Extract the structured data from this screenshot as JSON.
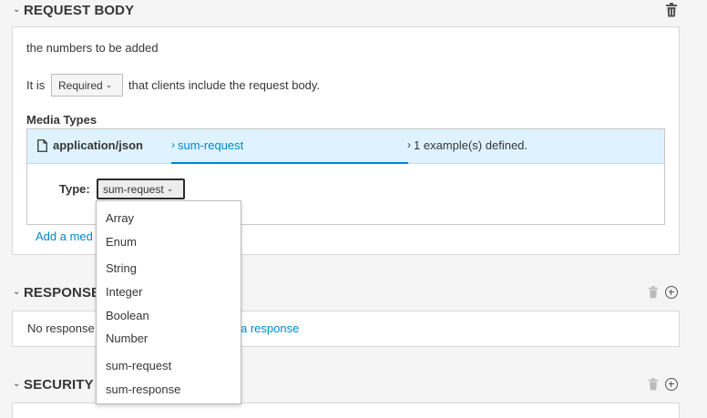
{
  "request_body": {
    "title": "REQUEST BODY",
    "description": "the numbers to be added",
    "it_is": "It is",
    "required_value": "Required",
    "sentence_tail": "that clients include the request body.",
    "media_types_label": "Media Types",
    "media_type": {
      "name": "application/json",
      "schema_ref": "sum-request",
      "examples": "1 example(s) defined."
    },
    "type_label": "Type:",
    "type_value": "sum-request",
    "add_media_link": "Add a med"
  },
  "responses": {
    "title": "RESPONSE",
    "empty_text": "No response",
    "add_link": "a response"
  },
  "security": {
    "title": "SECURITY I"
  },
  "type_dropdown": {
    "options": [
      "Array",
      "Enum",
      "String",
      "Integer",
      "Boolean",
      "Number",
      "sum-request",
      "sum-response"
    ]
  }
}
